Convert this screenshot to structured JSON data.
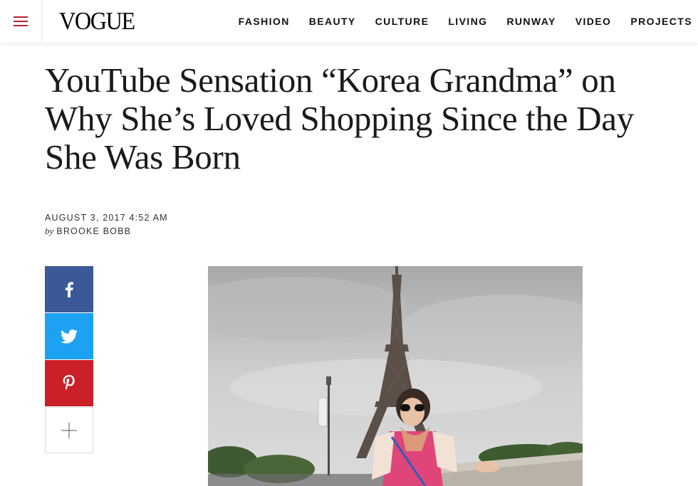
{
  "header": {
    "logo": "VOGUE",
    "nav": [
      "FASHION",
      "BEAUTY",
      "CULTURE",
      "LIVING",
      "RUNWAY",
      "VIDEO",
      "PROJECTS"
    ]
  },
  "article": {
    "headline": "YouTube Sensation “Korea Grandma” on Why She’s Loved Shopping Since the Day She Was Born",
    "date": "AUGUST 3, 2017 4:52 AM",
    "by": "by",
    "author": "BROOKE BOBB"
  },
  "share": {
    "buttons": [
      "facebook-icon",
      "twitter-icon",
      "pinterest-icon",
      "plus-icon"
    ]
  },
  "colors": {
    "menu_icon": "#b0262d",
    "facebook": "#3b5998",
    "twitter": "#1da1f2",
    "pinterest": "#cb2027",
    "text": "#111111"
  }
}
